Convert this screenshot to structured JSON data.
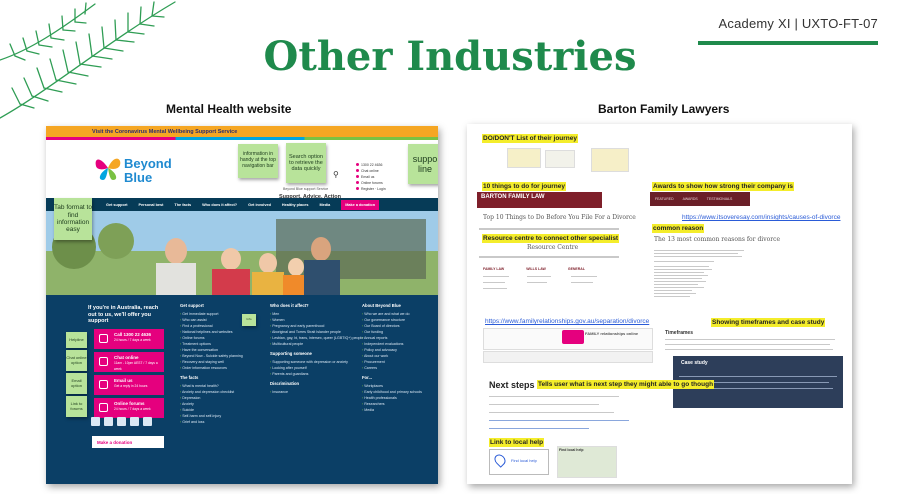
{
  "slide": {
    "header": "Academy XI | UXTO-FT-07",
    "title": "Other Industries",
    "colors": {
      "accent": "#1f8a4c",
      "sticky": "#b8e39a",
      "highlight": "#f4ed2b"
    }
  },
  "left_panel": {
    "label": "Mental Health website",
    "site": {
      "top_banner": "Visit the Coronavirus Mental Wellbeing Support Service",
      "logo_line1": "Beyond",
      "logo_line2": "Blue",
      "search_icon": "search-icon",
      "contacts": [
        "1300 22 4636",
        "Chat online",
        "Email us",
        "Online forums",
        "Register · Login"
      ],
      "sub_link": "Beyond Blue support Service",
      "tagline": "Support. Advice. Action",
      "nav": [
        "Get support",
        "Personal best",
        "The facts",
        "Who does it affect?",
        "Get involved",
        "Healthy places",
        "Media",
        "Make a donation"
      ],
      "reach_text": "If you're in Australia, reach out to us, we'll offer you support",
      "contact_buttons": [
        {
          "title": "Call 1300 22 4636",
          "sub": "24 hours / 7 days a week"
        },
        {
          "title": "Chat online",
          "sub": "11am - 10pm AEST / 7 days a week"
        },
        {
          "title": "Email us",
          "sub": "Get a reply in 24 hours"
        },
        {
          "title": "Online forums",
          "sub": "24 hours / 7 days a week"
        }
      ],
      "donate": "Make a donation",
      "columns": [
        {
          "heading": "Get support",
          "items": [
            "Get immediate support",
            "Who can assist",
            "Find a professional",
            "National helplines and websites",
            "Online forums",
            "Treatment options",
            "Have the conversation",
            "Beyond Now - Suicide safety planning",
            "Recovery and staying well",
            "Order information resources"
          ]
        },
        {
          "heading": "Who does it affect?",
          "items": [
            "Men",
            "Women",
            "Pregnancy and early parenthood",
            "Aboriginal and Torres Strait Islander people",
            "Lesbian, gay, bi, trans, intersex, queer (LGBTIQ+) people",
            "Multicultural people"
          ]
        },
        {
          "heading": "About Beyond Blue",
          "items": [
            "Who we are and what we do",
            "Our governance structure",
            "Our Board of directors",
            "Our funding",
            "Annual reports",
            "Independent evaluations",
            "Policy and advocacy",
            "About our work",
            "Procurement",
            "Careers"
          ]
        }
      ],
      "the_facts": {
        "heading": "The facts",
        "items": [
          "What is mental health?",
          "Anxiety and depression checklist",
          "Depression",
          "Anxiety",
          "Suicide",
          "Self-harm and self-injury",
          "Grief and loss"
        ]
      },
      "supporting": {
        "heading": "Supporting someone",
        "items": [
          "Supporting someone with depression or anxiety",
          "Looking after yourself",
          "Parents and guardians"
        ]
      },
      "for": {
        "heading": "For...",
        "items": [
          "Workplaces",
          "Early childhood and primary schools",
          "Health professionals",
          "Researchers",
          "Media"
        ]
      },
      "discrimination": {
        "heading": "Discrimination",
        "items": [
          "Insurance"
        ]
      }
    },
    "stickies": {
      "top_nav": "information in handy at the top navigation bar",
      "search": "Search option to retrieve the data quickly",
      "support": "suppo line",
      "tab_format": "Tab format to find information easy",
      "helpline": "Helpline",
      "chat": "Chat online option",
      "email": "Email option",
      "link_forums": "Link to forums",
      "small": "Info"
    }
  },
  "right_panel": {
    "label": "Barton Family Lawyers",
    "highlights": {
      "dodont": "DO/DON'T List of their journey",
      "ten_things": "10 things to do for journey",
      "awards": "Awards to show how strong their company is",
      "resource": "Resource centre to connect  other specialist",
      "common": "common reason",
      "timeframes": "Showing timeframes and case study",
      "next_steps": "Tells user what is next step they might able to go though",
      "local_help": "Link to local help"
    },
    "links": {
      "itseasy": "https://www.itsoveresay.com/insights/causes-of-divorce",
      "family": "https://www.familyrelationships.gov.au/separation/divorce"
    },
    "page": {
      "logo": "BARTON FAMILY LAW",
      "top10_title": "Top 10 Things to Do Before You File For a Divorce",
      "resource_centre": "Resource Centre",
      "causes_title": "The 13 most common reasons for divorce",
      "family_logo": "FAMILY relationships online",
      "timeframes": "Timeframes",
      "case_study": "Case study",
      "next_steps": "Next steps",
      "find_local_help": "Find local help",
      "find_local_help_map": "Find local help",
      "award_tabs": [
        "FEATURED",
        "AWARDS",
        "TESTIMONIALS"
      ],
      "resource_cols": [
        "FAMILY LAW",
        "WILLS LAW",
        "GENERAL"
      ]
    }
  }
}
